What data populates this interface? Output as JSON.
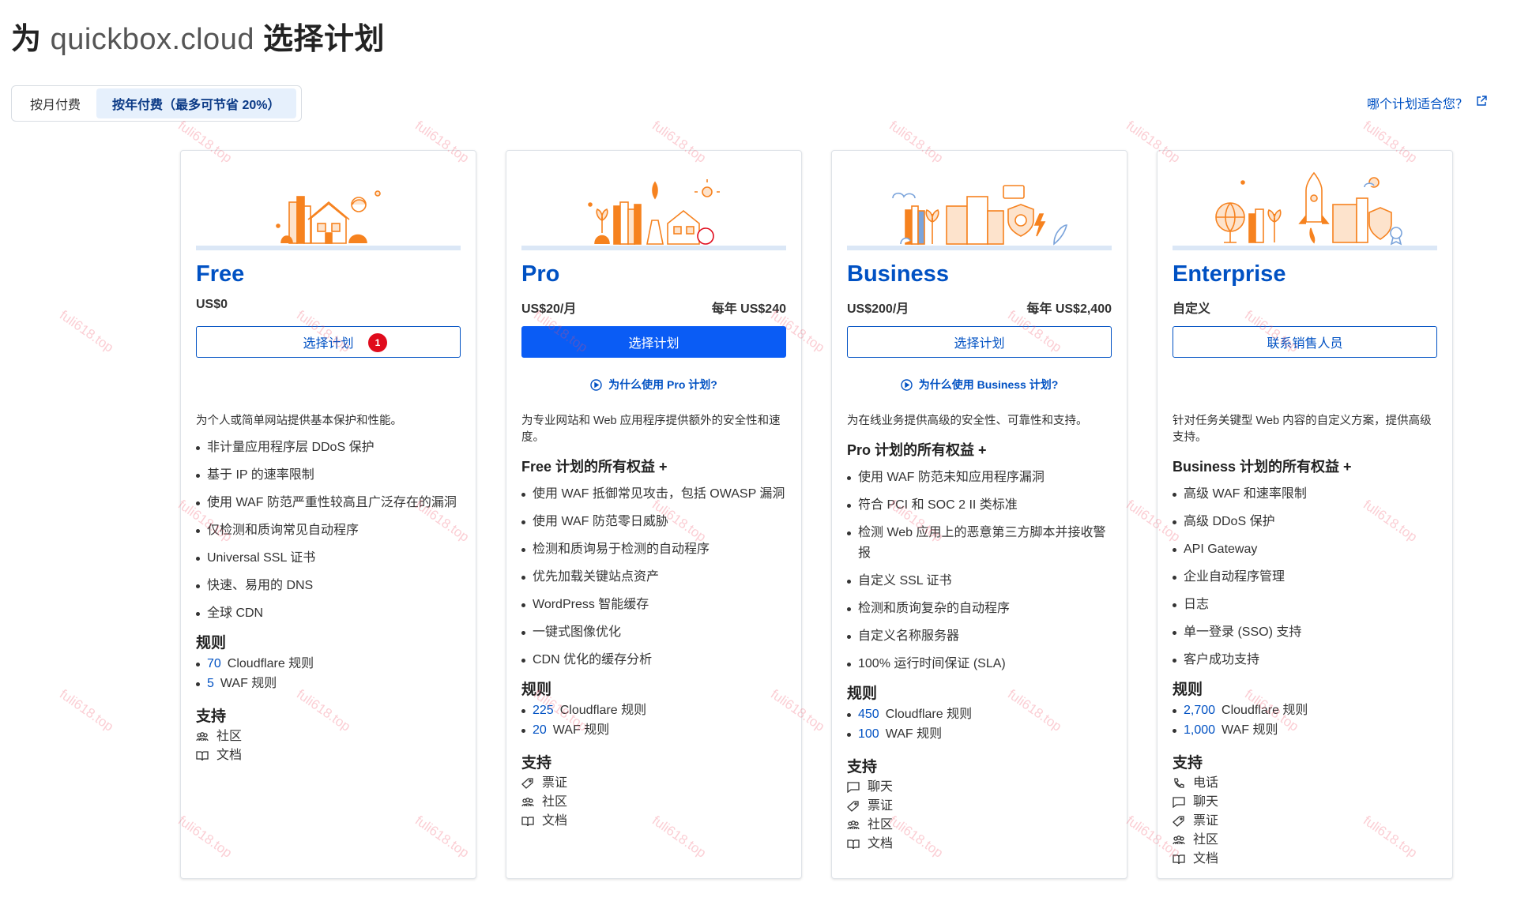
{
  "header": {
    "title_prefix": "为",
    "title_domain": "quickbox.cloud",
    "title_suffix": "选择计划"
  },
  "billing": {
    "monthly_label": "按月付费",
    "annual_label": "按年付费（最多可节省 20%）",
    "selected": "annual"
  },
  "help_link": {
    "label": "哪个计划适合您？",
    "icon": "external-link-icon"
  },
  "colors": {
    "accent": "#0051c3",
    "primary_button": "#0a5cf5",
    "badge": "#e00b1c",
    "illustration_orange": "#f6821f"
  },
  "plans": [
    {
      "name": "Free",
      "price": "US$0",
      "annual_price": "",
      "cta": "选择计划",
      "badge": "1",
      "why_link": "",
      "description": "为个人或简单网站提供基本保护和性能。",
      "includes_label": "",
      "features": [
        "非计量应用程序层 DDoS 保护",
        "基于 IP 的速率限制",
        "使用 WAF 防范严重性较高且广泛存在的漏洞",
        "仅检测和质询常见自动程序",
        "Universal SSL 证书",
        "快速、易用的 DNS",
        "全球 CDN"
      ],
      "rules_title": "规则",
      "rules": [
        {
          "num": "70",
          "label": "Cloudflare 规则"
        },
        {
          "num": "5",
          "label": "WAF 规则"
        }
      ],
      "support_title": "支持",
      "support": [
        {
          "icon": "community-icon",
          "label": "社区"
        },
        {
          "icon": "docs-icon",
          "label": "文档"
        }
      ]
    },
    {
      "name": "Pro",
      "price": "US$20/月",
      "annual_price": "每年 US$240",
      "cta": "选择计划",
      "badge": "",
      "why_link": "为什么使用 Pro 计划?",
      "description": "为专业网站和 Web 应用程序提供额外的安全性和速度。",
      "includes_label": "Free 计划的所有权益 +",
      "features": [
        "使用 WAF 抵御常见攻击，包括 OWASP 漏洞",
        "使用 WAF 防范零日威胁",
        "检测和质询易于检测的自动程序",
        "优先加载关键站点资产",
        "WordPress 智能缓存",
        "一键式图像优化",
        "CDN 优化的缓存分析"
      ],
      "rules_title": "规则",
      "rules": [
        {
          "num": "225",
          "label": "Cloudflare 规则"
        },
        {
          "num": "20",
          "label": "WAF 规则"
        }
      ],
      "support_title": "支持",
      "support": [
        {
          "icon": "ticket-icon",
          "label": "票证"
        },
        {
          "icon": "community-icon",
          "label": "社区"
        },
        {
          "icon": "docs-icon",
          "label": "文档"
        }
      ]
    },
    {
      "name": "Business",
      "price": "US$200/月",
      "annual_price": "每年 US$2,400",
      "cta": "选择计划",
      "badge": "",
      "why_link": "为什么使用 Business 计划?",
      "description": "为在线业务提供高级的安全性、可靠性和支持。",
      "includes_label": "Pro 计划的所有权益 +",
      "features": [
        "使用 WAF 防范未知应用程序漏洞",
        "符合 PCI 和 SOC 2 II 类标准",
        "检测 Web 应用上的恶意第三方脚本并接收警报",
        "自定义 SSL 证书",
        "检测和质询复杂的自动程序",
        "自定义名称服务器",
        "100% 运行时间保证 (SLA)"
      ],
      "rules_title": "规则",
      "rules": [
        {
          "num": "450",
          "label": "Cloudflare 规则"
        },
        {
          "num": "100",
          "label": "WAF 规则"
        }
      ],
      "support_title": "支持",
      "support": [
        {
          "icon": "chat-icon",
          "label": "聊天"
        },
        {
          "icon": "ticket-icon",
          "label": "票证"
        },
        {
          "icon": "community-icon",
          "label": "社区"
        },
        {
          "icon": "docs-icon",
          "label": "文档"
        }
      ]
    },
    {
      "name": "Enterprise",
      "price": "自定义",
      "annual_price": "",
      "cta": "联系销售人员",
      "badge": "",
      "why_link": "",
      "description": "针对任务关键型 Web 内容的自定义方案，提供高级支持。",
      "includes_label": "Business 计划的所有权益 +",
      "features": [
        "高级 WAF 和速率限制",
        "高级 DDoS 保护",
        "API Gateway",
        "企业自动程序管理",
        "日志",
        "单一登录 (SSO) 支持",
        "客户成功支持"
      ],
      "rules_title": "规则",
      "rules": [
        {
          "num": "2,700",
          "label": "Cloudflare 规则"
        },
        {
          "num": "1,000",
          "label": "WAF 规则"
        }
      ],
      "support_title": "支持",
      "support": [
        {
          "icon": "phone-icon",
          "label": "电话"
        },
        {
          "icon": "chat-icon",
          "label": "聊天"
        },
        {
          "icon": "ticket-icon",
          "label": "票证"
        },
        {
          "icon": "community-icon",
          "label": "社区"
        },
        {
          "icon": "docs-icon",
          "label": "文档"
        }
      ]
    }
  ],
  "watermark_text": "fuli618.top"
}
